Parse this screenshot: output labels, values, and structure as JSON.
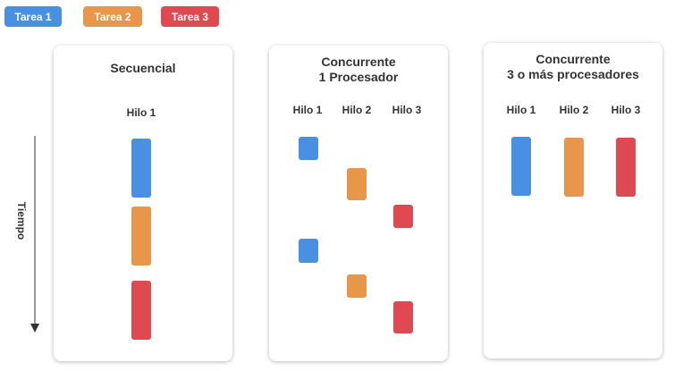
{
  "colors": {
    "task1": "#4a90e2",
    "task2": "#e8964a",
    "task3": "#df4a52"
  },
  "legend": [
    {
      "label": "Tarea 1",
      "color": "#4a90e2"
    },
    {
      "label": "Tarea 2",
      "color": "#e8964a"
    },
    {
      "label": "Tarea 3",
      "color": "#df4a52"
    }
  ],
  "axis": {
    "label": "Tiempo"
  },
  "panels": [
    {
      "title": "Secuencial",
      "threads": [
        "Hilo 1"
      ]
    },
    {
      "title": "Concurrente\n1 Procesador",
      "threads": [
        "Hilo 1",
        "Hilo 2",
        "Hilo 3"
      ]
    },
    {
      "title": "Concurrente\n3 o más procesadores",
      "threads": [
        "Hilo 1",
        "Hilo 2",
        "Hilo 3"
      ]
    }
  ]
}
